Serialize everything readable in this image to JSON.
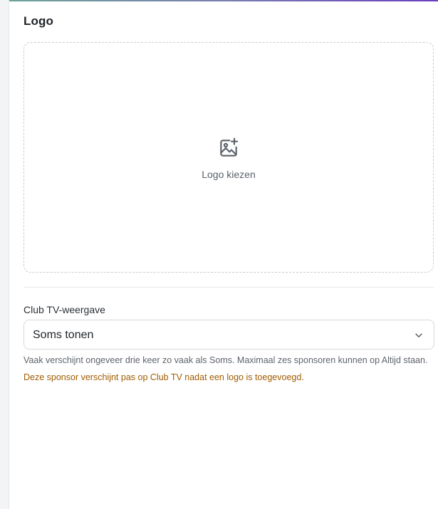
{
  "logo_section": {
    "title": "Logo",
    "upload_label": "Logo kiezen",
    "upload_icon": "image-add-icon"
  },
  "club_tv": {
    "label": "Club TV-weergave",
    "selected_value": "Soms tonen",
    "help_text": "Vaak verschijnt ongeveer drie keer zo vaak als Soms. Maximaal zes sponsoren kunnen op Altijd staan.",
    "warning_text": "Deze sponsor verschijnt pas op Club TV nadat een logo is toegevoegd."
  },
  "colors": {
    "warning": "#a15c00",
    "border": "#d7d9dd",
    "dashed_border": "#c9ccd1",
    "accent_start": "#6fa39a",
    "accent_end": "#6a3fc0"
  }
}
